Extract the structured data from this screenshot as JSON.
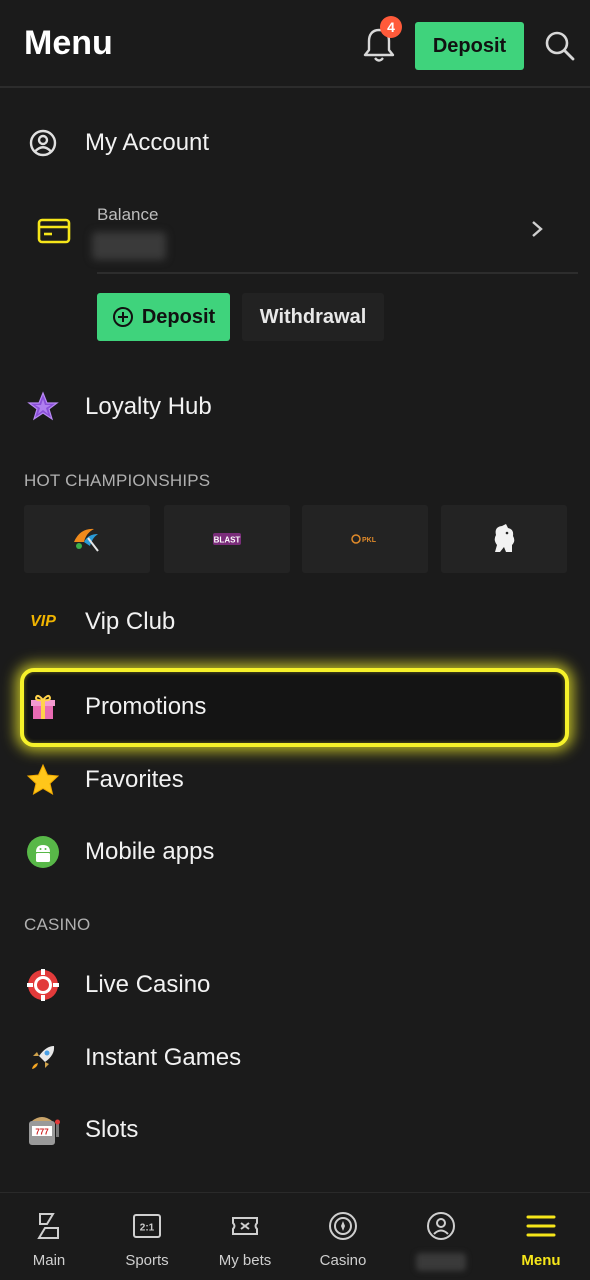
{
  "header": {
    "title": "Menu",
    "notification_count": "4",
    "deposit_label": "Deposit"
  },
  "account": {
    "label": "My Account"
  },
  "balance": {
    "label": "Balance",
    "value": ""
  },
  "actions": {
    "deposit_label": "Deposit",
    "withdrawal_label": "Withdrawal"
  },
  "loyalty": {
    "label": "Loyalty Hub"
  },
  "hot_championships": {
    "title": "HOT CHAMPIONSHIPS",
    "items": [
      {
        "icon": "cricket-league-logo"
      },
      {
        "icon": "blast-logo"
      },
      {
        "icon": "pkl-logo"
      },
      {
        "icon": "premier-league-lion-logo"
      }
    ]
  },
  "vip": {
    "icon_text": "VIP",
    "label": "Vip Club"
  },
  "promotions": {
    "label": "Promotions"
  },
  "favorites": {
    "label": "Favorites"
  },
  "mobile_apps": {
    "label": "Mobile apps"
  },
  "casino": {
    "title": "CASINO",
    "items": [
      {
        "label": "Live Casino",
        "icon": "casino-chip-icon"
      },
      {
        "label": "Instant Games",
        "icon": "rocket-icon"
      },
      {
        "label": "Slots",
        "icon": "slot-machine-icon"
      }
    ]
  },
  "bottom_nav": {
    "items": [
      {
        "label": "Main",
        "icon": "main-icon"
      },
      {
        "label": "Sports",
        "icon": "scoreboard-icon"
      },
      {
        "label": "My bets",
        "icon": "ticket-icon"
      },
      {
        "label": "Casino",
        "icon": "roulette-icon"
      },
      {
        "label": "",
        "icon": "profile-icon"
      },
      {
        "label": "Menu",
        "icon": "hamburger-icon",
        "active": true
      }
    ]
  },
  "colors": {
    "background": "#1b1b1b",
    "accent_green": "#3fd37c",
    "highlight_yellow": "#f6f22a",
    "active_nav": "#f6e61a",
    "badge": "#ff5a3a"
  }
}
